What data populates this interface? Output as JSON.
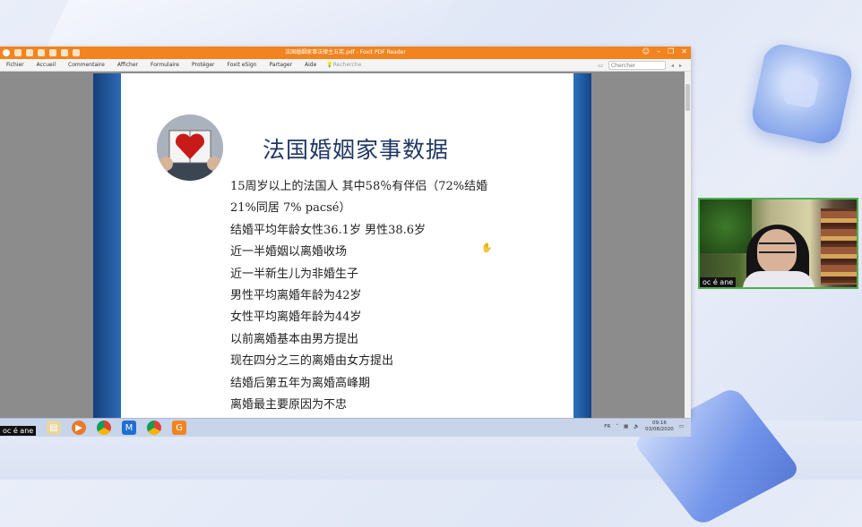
{
  "window": {
    "title": "法国婚姻家事法律主五宪.pdf - Foxit PDF Reader"
  },
  "menu": {
    "items": [
      "Fichier",
      "Accueil",
      "Commentaire",
      "Afficher",
      "Formulaire",
      "Protéger",
      "Foxit eSign",
      "Partager",
      "Aide"
    ],
    "search_placeholder": "Recherche",
    "right_search_placeholder": "Chercher"
  },
  "slide": {
    "title": "法国婚姻家事数据",
    "bullets": [
      "15周岁以上的法国人 其中58％有伴侣（72%结婚",
      "21%同居 7% pacsé）",
      "结婚平均年龄女性36.1岁 男性38.6岁",
      "近一半婚姻以离婚收场",
      "近一半新生儿为非婚生子",
      "男性平均离婚年龄为42岁",
      "女性平均离婚年龄为44岁",
      "以前离婚基本由男方提出",
      "现在四分之三的离婚由女方提出",
      "结婚后第五年为离婚高峰期",
      "离婚最主要原因为不忠"
    ]
  },
  "taskbar": {
    "start_label": "oc é ane",
    "lang": "FR",
    "time": "09:16",
    "date": "03/08/2020"
  },
  "webcam": {
    "label": "oc é ane"
  }
}
